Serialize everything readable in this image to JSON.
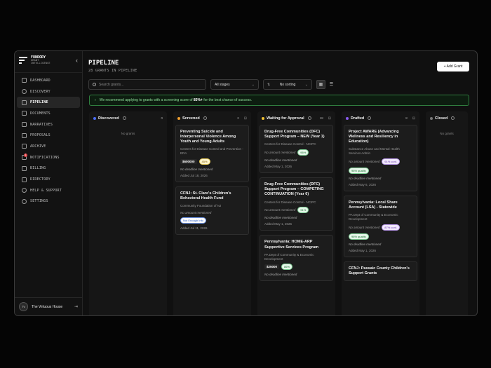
{
  "brand": {
    "name": "FUNDORY",
    "sub1": "GRANT",
    "sub2": "INTELLIGENCE"
  },
  "nav": [
    {
      "label": "DASHBOARD",
      "icon": "grid-icon"
    },
    {
      "label": "DISCOVERY",
      "icon": "search-icon"
    },
    {
      "label": "PIPELINE",
      "icon": "kanban-icon",
      "active": true
    },
    {
      "label": "DOCUMENTS",
      "icon": "document-icon"
    },
    {
      "label": "NARRATIVES",
      "icon": "text-icon"
    },
    {
      "label": "PROPOSALS",
      "icon": "file-icon"
    },
    {
      "label": "ARCHIVE",
      "icon": "archive-icon"
    },
    {
      "label": "NOTIFICATIONS",
      "icon": "bell-icon",
      "badge": "1"
    },
    {
      "label": "BILLING",
      "icon": "card-icon"
    },
    {
      "label": "DIRECTORY",
      "icon": "book-icon"
    },
    {
      "label": "HELP & SUPPORT",
      "icon": "help-icon"
    },
    {
      "label": "SETTINGS",
      "icon": "gear-icon"
    }
  ],
  "user": {
    "initials": "TV",
    "name": "The Virtuous House"
  },
  "header": {
    "title": "PIPELINE",
    "subtitle": "28 GRANTS IN PIPELINE",
    "add_label": "+ Add Grant"
  },
  "toolbar": {
    "search_placeholder": "Search grants...",
    "stage": "All stages",
    "sort": "No sorting"
  },
  "banner": {
    "pre": "We recommend applying to grants with a screening score of ",
    "bold": "85%+",
    "post": " for the best chance of success."
  },
  "columns": [
    {
      "title": "Discovered",
      "count": "0",
      "color": "#4a6cf7",
      "empty": "No grants"
    },
    {
      "title": "Screened",
      "count": "2",
      "color": "#f0a030"
    },
    {
      "title": "Waiting for Approval",
      "count": "18",
      "color": "#f0c030"
    },
    {
      "title": "Drafted",
      "count": "8",
      "color": "#8a5cf0"
    },
    {
      "title": "Closed",
      "count": "",
      "color": "",
      "empty": "No grants"
    }
  ],
  "cards": {
    "screened": [
      {
        "title": "Preventing Suicide and Interpersonal Violence Among Youth and Young Adults",
        "org": "Centers for Disease Control and Prevention - ERA",
        "amount": "$600000",
        "badge": "45%",
        "deadline": "No deadline mentioned",
        "added": "Added Jul 18, 2026"
      },
      {
        "title": "CFNJ: St. Clare's Children's Behavioral Health Fund",
        "org": "Community Foundation of NJ",
        "amount_none": "No amount mentioned",
        "badge": "Not Enough Info",
        "added": "Added Jul 11, 2026"
      }
    ],
    "waiting": [
      {
        "title": "Drug-Free Communities (DFC) Support Program – NEW (Year 1)",
        "org": "Centers for Disease Control - NCIPC",
        "amount_none": "No amount mentioned",
        "badge": "96%",
        "deadline": "No deadline mentioned",
        "added": "Added May 1, 2026"
      },
      {
        "title": "Drug-Free Communities (DFC) Support Program – COMPETING CONTINUATION (Year 6)",
        "org": "Centers for Disease Control - NCIPC",
        "amount_none": "No amount mentioned",
        "badge": "91%",
        "deadline": "No deadline mentioned",
        "added": "Added May 1, 2026"
      },
      {
        "title": "Pennsylvania: HOME-ARP Supportive Services Program",
        "org": "PA Dept of Community & Economic Development",
        "amount": "$25000",
        "badge": "86%",
        "deadline": "No deadline mentioned"
      }
    ],
    "drafted": [
      {
        "title": "Project AWARE (Advancing Wellness and Resiliency in Education)",
        "org": "Substance Abuse and Mental Health Services Admin",
        "amount_none": "No amount mentioned",
        "badge": "91% conf.",
        "badge2": "96% quality",
        "deadline": "No deadline mentioned",
        "added": "Added May 6, 2026"
      },
      {
        "title": "Pennsylvania: Local Share Account (LSA) - Statewide",
        "org": "PA Dept of Community & Economic Development",
        "amount_none": "No amount mentioned",
        "badge": "87% conf.",
        "badge2": "96% quality",
        "deadline": "No deadline mentioned",
        "added": "Added May 1, 2026"
      },
      {
        "title": "CFNJ: Passaic County Children's Support Grants"
      }
    ]
  }
}
